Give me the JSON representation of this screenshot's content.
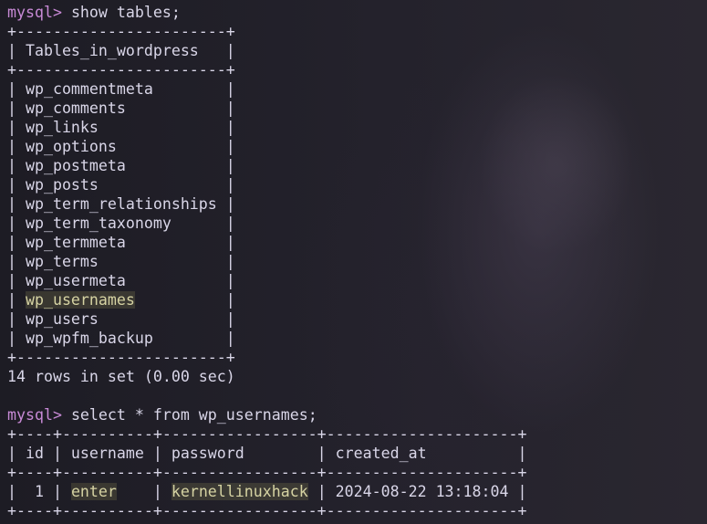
{
  "terminal": {
    "prompt": "mysql>",
    "command_1": " show tables;",
    "table_1": {
      "border": "+-----------------------+",
      "header_row": "| Tables_in_wordpress   |",
      "rows": [
        {
          "pre": "| ",
          "name": "wp_commentmeta",
          "post": "        |"
        },
        {
          "pre": "| ",
          "name": "wp_comments",
          "post": "           |"
        },
        {
          "pre": "| ",
          "name": "wp_links",
          "post": "              |"
        },
        {
          "pre": "| ",
          "name": "wp_options",
          "post": "            |"
        },
        {
          "pre": "| ",
          "name": "wp_postmeta",
          "post": "           |"
        },
        {
          "pre": "| ",
          "name": "wp_posts",
          "post": "              |"
        },
        {
          "pre": "| ",
          "name": "wp_term_relationships",
          "post": " |"
        },
        {
          "pre": "| ",
          "name": "wp_term_taxonomy",
          "post": "      |"
        },
        {
          "pre": "| ",
          "name": "wp_termmeta",
          "post": "           |"
        },
        {
          "pre": "| ",
          "name": "wp_terms",
          "post": "              |"
        },
        {
          "pre": "| ",
          "name": "wp_usermeta",
          "post": "           |"
        },
        {
          "pre": "| ",
          "name": "wp_usernames",
          "post": "          |"
        },
        {
          "pre": "| ",
          "name": "wp_users",
          "post": "              |"
        },
        {
          "pre": "| ",
          "name": "wp_wpfm_backup",
          "post": "        |"
        }
      ],
      "summary": "14 rows in set (0.00 sec)"
    },
    "command_2": " select * from wp_usernames;",
    "table_2": {
      "border": "+----+----------+-----------------+---------------------+",
      "header_row": "| id | username | password        | created_at          |",
      "row": {
        "seg_1": "|  1 | ",
        "username": "enter",
        "seg_2": "    | ",
        "password": "kernellinuxhack",
        "seg_3": " | 2024-08-22 13:18:04 |"
      },
      "partial_line": "+----+----------+-----------------+---------------------+"
    }
  },
  "colors": {
    "background": "#1f1e27",
    "text": "#d9d6e8",
    "prompt": "#c88ad6",
    "highlight_text": "#d6d3a3"
  }
}
